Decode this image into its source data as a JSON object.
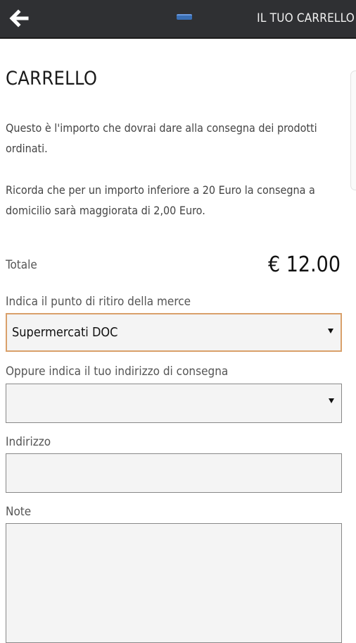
{
  "header": {
    "title": "IL TUO CARRELLO",
    "back_icon": "arrow-left-icon",
    "menu_icon": "menu-grip-icon",
    "background_color": "#2f3033"
  },
  "page": {
    "title": "CARRELLO",
    "intro": "Questo è l'importo che dovrai dare alla consegna dei prodotti ordinati.",
    "notice": "Ricorda che per un importo inferiore a 20 Euro la consegna a domicilio sarà maggiorata di 2,00 Euro."
  },
  "total": {
    "label": "Totale",
    "value": "€ 12.00"
  },
  "form": {
    "pickup": {
      "label": "Indica il punto di ritiro della merce",
      "selected": "Supermercati DOC",
      "focus_color": "#d9a06a"
    },
    "delivery": {
      "label": "Oppure indica il tuo indirizzo di consegna",
      "selected": ""
    },
    "address": {
      "label": "Indirizzo",
      "value": ""
    },
    "notes": {
      "label": "Note",
      "value": ""
    }
  }
}
